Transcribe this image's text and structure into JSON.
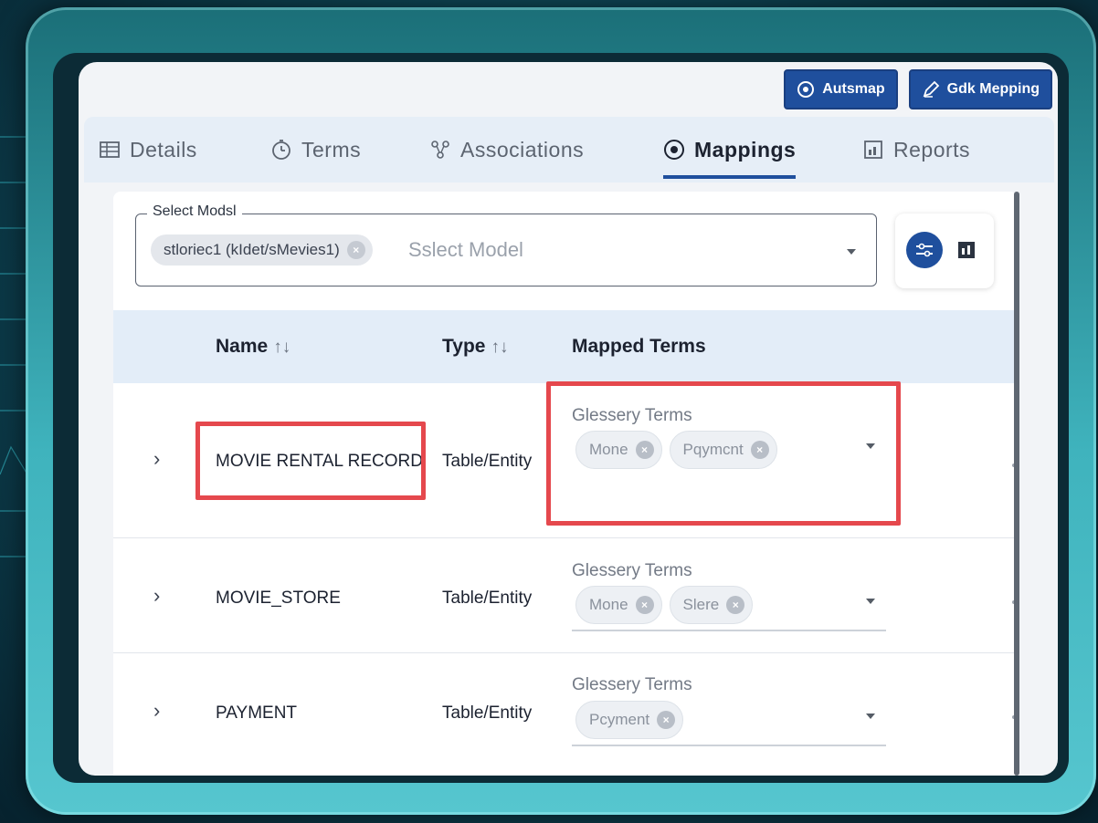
{
  "actions": {
    "automap_label": "Autsmap",
    "edit_mapping_label": "Gdk Mepping"
  },
  "tabs": [
    {
      "label": "Details",
      "icon": "table-icon",
      "active": false
    },
    {
      "label": "Terms",
      "icon": "clock-icon",
      "active": false
    },
    {
      "label": "Associations",
      "icon": "network-icon",
      "active": false
    },
    {
      "label": "Mappings",
      "icon": "mapping-icon",
      "active": true
    },
    {
      "label": "Reports",
      "icon": "report-icon",
      "active": false
    }
  ],
  "model_select": {
    "legend": "Select Modsl",
    "selected_chip": "stloriec1 (kIdet/sMevies1)",
    "placeholder": "Sslect Model"
  },
  "table": {
    "headers": {
      "name": "Name",
      "type": "Type",
      "mapped_terms": "Mapped Terms",
      "sort_glyph": "↑↓"
    },
    "rows": [
      {
        "name": "MOVIE RENTAL RECORD",
        "type": "Table/Entity",
        "terms_label": "Glessery Terms",
        "terms": [
          "Mone",
          "Pqymcnt"
        ],
        "highlighted": true
      },
      {
        "name": "MOVIE_STORE",
        "type": "Table/Entity",
        "terms_label": "Glessery Terms",
        "terms": [
          "Mone",
          "Slere"
        ],
        "highlighted": false
      },
      {
        "name": "PAYMENT",
        "type": "Table/Entity",
        "terms_label": "Glessery Terms",
        "terms": [
          "Pcyment"
        ],
        "highlighted": false
      }
    ]
  },
  "colors": {
    "primary": "#1f4f9d",
    "highlight": "#e5484d",
    "header_bg": "#e3edf8"
  }
}
